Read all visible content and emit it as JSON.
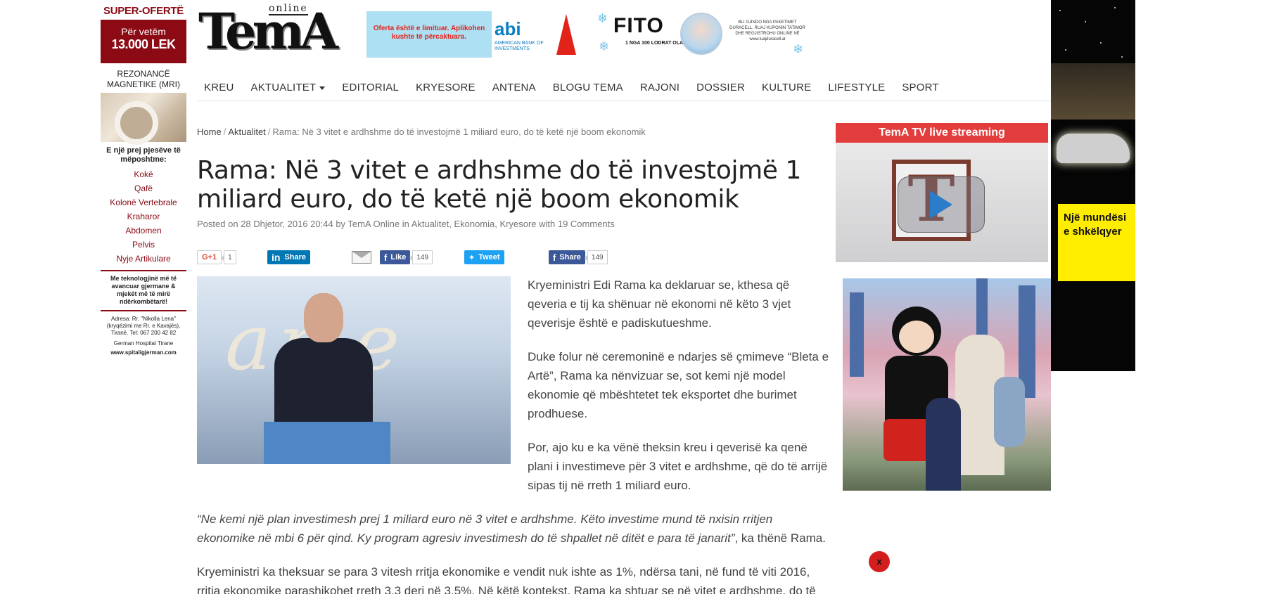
{
  "left_ad": {
    "title": "SUPER-OFERTË",
    "price_line1": "Për vetëm",
    "price_line2": "13.000 LEK",
    "mri_label": "REZONANCË MAGNETIKE (MRI)",
    "question": "E një prej pjesëve të mëposhtme:",
    "body_parts": [
      "Kokë",
      "Qafë",
      "Kolonë Vertebrale",
      "Kraharor",
      "Abdomen",
      "Pelvis",
      "Nyje Artikulare"
    ],
    "tech": "Me teknologjinë më të avancuar gjermane & mjekët më të mirë ndërkombëtarë!",
    "address": "Adresa: Rr. \"Nikolla Lena\" (kryqëzimi me Rr. e Kavajës), Tiranë. Tel: 067 200 42 82",
    "hospital": "German Hospital Tirane",
    "website": "www.spitaligjerman.com"
  },
  "header": {
    "logo_online": "online",
    "logo_text": "TemA",
    "abi_offer": "Oferta është e limituar. Aplikohen kushte të përcaktuara.",
    "abi_logo": "abi",
    "abi_sub": "AMERICAN BANK OF INVESTMENTS",
    "fito_logo": "FITO",
    "fito_sub": "1 NGA 100 LODRAT OLAF",
    "fito_text": "BLI GJINDO NGA PAKETIMET DURACELL, RUAJ KUPONIN TATIMOR DHE REGJISTROHU ONLINE NË www.luajduracell.al"
  },
  "nav": {
    "items": [
      "KREU",
      "AKTUALITET",
      "EDITORIAL",
      "KRYESORE",
      "ANTENA",
      "BLOGU TEMA",
      "RAJONI",
      "DOSSIER",
      "KULTURE",
      "LIFESTYLE",
      "SPORT"
    ]
  },
  "breadcrumb": {
    "home": "Home",
    "section": "Aktualitet",
    "current": "Rama: Në 3 vitet e ardhshme do të investojmë 1 miliard euro, do të ketë një boom ekonomik"
  },
  "article": {
    "title": "Rama: Në 3 vitet e ardhshme do të investojmë 1 miliard euro, do të ketë një boom ekonomik",
    "meta": "Posted on 28 Dhjetor, 2016 20:44 by TemA Online in Aktualitet, Ekonomia, Kryesore with 19 Comments",
    "p1": "Kryeministri Edi Rama ka deklaruar se, kthesa që qeveria e tij ka shënuar në ekonomi në këto 3 vjet qeverisje është e padiskutueshme.",
    "p2": "Duke folur në ceremoninë e ndarjes së çmimeve “Bleta e Artë”, Rama ka nënvizuar se, sot kemi një model ekonomie që mbështetet tek eksportet dhe burimet prodhuese.",
    "p3": "Por, ajo ku e ka vënë theksin kreu i qeverisë ka qenë plani i investimeve për 3 vitet e ardhshme, që do të arrijë sipas tij në rreth 1 miliard euro.",
    "quote": "“Ne kemi një plan investimesh prej 1 miliard euro në 3 vitet e ardhshme. Këto investime mund të nxisin rritjen ekonomike në mbi 6 për qind. Ky program agresiv investimesh do të shpallet në ditët e para të janarit”",
    "quote_tail": ", ka thënë Rama.",
    "p4": "Kryeministri ka theksuar se para 3 vitesh rritja ekonomike e vendit nuk ishte as 1%, ndërsa tani, në fund të viti 2016, rritja ekonomike parashikohet rreth 3.3 deri në 3.5%. Në këtë kontekst, Rama ka shtuar se në vitet e ardhshme, do të"
  },
  "share": {
    "gplus_label": "G+1",
    "gplus_count": "1",
    "linkedin_label": "Share",
    "fb_like_label": "Like",
    "fb_like_count": "149",
    "tweet_label": "Tweet",
    "fb_share_label": "Share",
    "fb_share_count": "149"
  },
  "sidebar": {
    "tv_title": "TemA TV live streaming",
    "tv_logo_letter": "T"
  },
  "right_ad": {
    "text": "Një mundësi e shkëlqyer"
  },
  "close_label": "x"
}
